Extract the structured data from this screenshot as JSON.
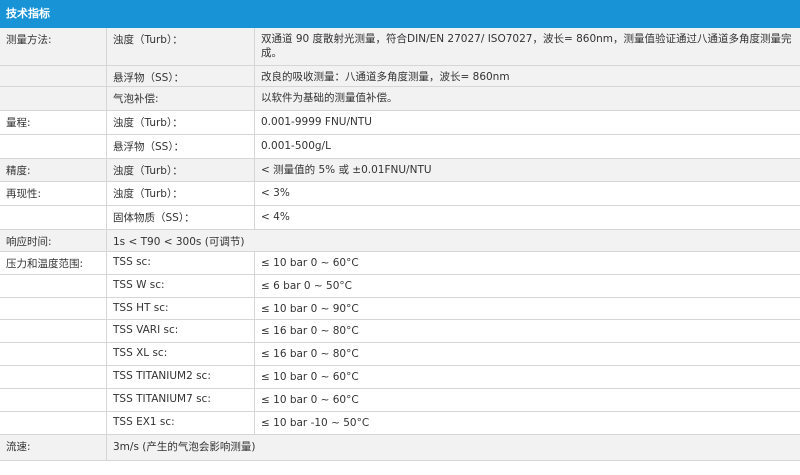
{
  "header": {
    "title": "技术指标"
  },
  "rows": [
    {
      "c1": "测量方法:",
      "c2": "浊度（Turb）：",
      "c3": "双通道 90 度散射光测量，符合DIN/EN 27027/ ISO7027，波长= 860nm，测量值验证通过八通道多角度测量完成。"
    },
    {
      "c1": "",
      "c2": "悬浮物（SS）：",
      "c3": "改良的吸收测量：八通道多角度测量，波长= 860nm"
    },
    {
      "c1": "",
      "c2": "气泡补偿:",
      "c3": "以软件为基础的测量值补偿。"
    },
    {
      "c1": "量程:",
      "c2": "浊度（Turb）：",
      "c3": "0.001-9999 FNU/NTU"
    },
    {
      "c1": "",
      "c2": "悬浮物（SS）：",
      "c3": "0.001-500g/L"
    },
    {
      "c1": "精度:",
      "c2": "浊度（Turb）：",
      "c3": "< 测量值的 5% 或 ±0.01FNU/NTU"
    },
    {
      "c1": "再现性:",
      "c2": "浊度（Turb）：",
      "c3": "< 3%"
    },
    {
      "c1": "",
      "c2": "固体物质（SS）：",
      "c3": "< 4%"
    },
    {
      "c1": "响应时间:",
      "c2": "1s < T90 < 300s (可调节)",
      "c3": ""
    },
    {
      "c1": "压力和温度范围:",
      "c2": "TSS sc:",
      "c3": "≤ 10 bar 0 ~  60°C"
    },
    {
      "c1": "",
      "c2": "TSS W sc:",
      "c3": "≤ 6 bar 0 ~  50°C"
    },
    {
      "c1": "",
      "c2": "TSS HT sc:",
      "c3": "≤ 10 bar 0 ~ 90°C"
    },
    {
      "c1": "",
      "c2": "TSS VARI sc:",
      "c3": "≤ 16 bar 0 ~ 80°C"
    },
    {
      "c1": "",
      "c2": "TSS XL sc:",
      "c3": "≤ 16 bar 0 ~  80°C"
    },
    {
      "c1": "",
      "c2": "TSS TITANIUM2 sc:",
      "c3": "≤ 10 bar 0 ~ 60°C"
    },
    {
      "c1": "",
      "c2": "TSS TITANIUM7 sc:",
      "c3": "≤ 10 bar 0 ~ 60°C"
    },
    {
      "c1": "",
      "c2": "TSS EX1 sc:",
      "c3": "≤ 10 bar -10 ~  50°C"
    },
    {
      "c1": "流速:",
      "c2": "3m/s (产生的气泡会影响测量)",
      "c3": ""
    }
  ]
}
